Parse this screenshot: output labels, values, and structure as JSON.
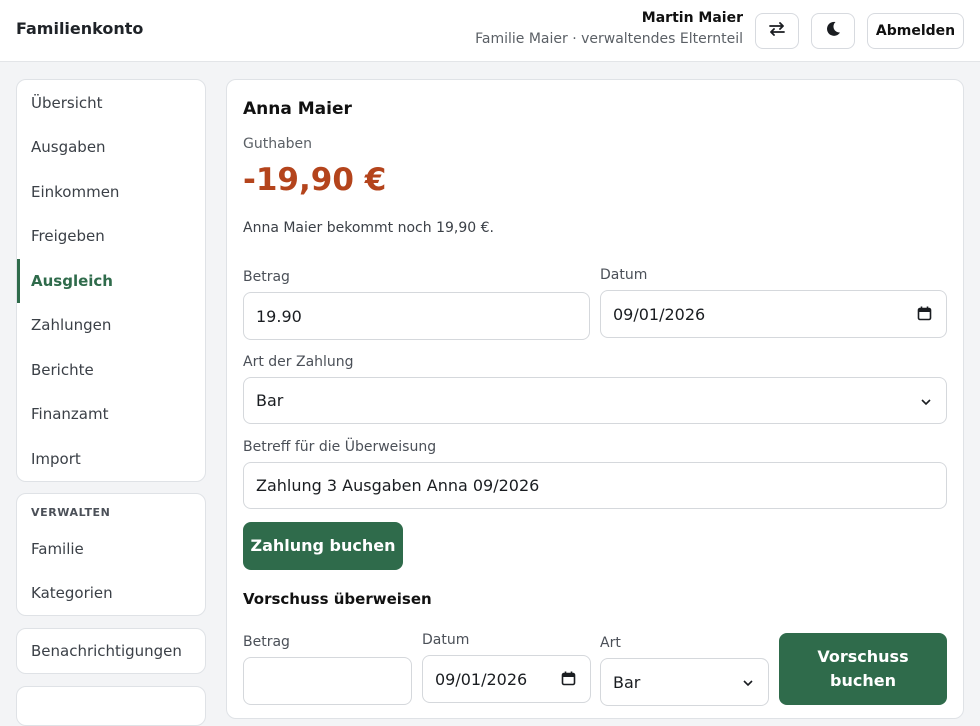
{
  "header": {
    "app_title": "Familienkonto",
    "user_name": "Martin Maier",
    "user_role": "Familie Maier · verwaltendes Elternteil",
    "swap_icon": "swap-icon",
    "theme_icon": "moon-icon",
    "logout_label": "Abmelden"
  },
  "nav": {
    "items": [
      {
        "label": "Übersicht"
      },
      {
        "label": "Ausgaben"
      },
      {
        "label": "Einkommen"
      },
      {
        "label": "Freigeben"
      },
      {
        "label": "Ausgleich",
        "active": true
      },
      {
        "label": "Zahlungen"
      },
      {
        "label": "Berichte"
      },
      {
        "label": "Finanzamt"
      },
      {
        "label": "Import"
      }
    ],
    "manage_heading": "VERWALTEN",
    "manage_items": [
      {
        "label": "Familie"
      },
      {
        "label": "Kategorien"
      }
    ],
    "notifications_label": "Benachrichtigungen"
  },
  "main": {
    "person_name": "Anna Maier",
    "balance_label": "Guthaben",
    "balance_value": "-19,90 €",
    "balance_note": "Anna Maier bekommt noch 19,90 €.",
    "payment": {
      "amount_label": "Betrag",
      "amount_value": "19.90",
      "date_label": "Datum",
      "date_value": "09/01/2026",
      "type_label": "Art der Zahlung",
      "type_value": "Bar",
      "reference_label": "Betreff für die Überweisung",
      "reference_value": "Zahlung 3 Ausgaben Anna 09/2026",
      "submit_label": "Zahlung buchen"
    },
    "advance": {
      "heading": "Vorschuss überweisen",
      "amount_label": "Betrag",
      "amount_value": "",
      "date_label": "Datum",
      "date_value": "09/01/2026",
      "type_label": "Art",
      "type_value": "Bar",
      "submit_label_line1": "Vorschuss",
      "submit_label_line2": "buchen"
    }
  },
  "colors": {
    "accent": "#2f6b4b",
    "negative_balance": "#b4441c"
  }
}
